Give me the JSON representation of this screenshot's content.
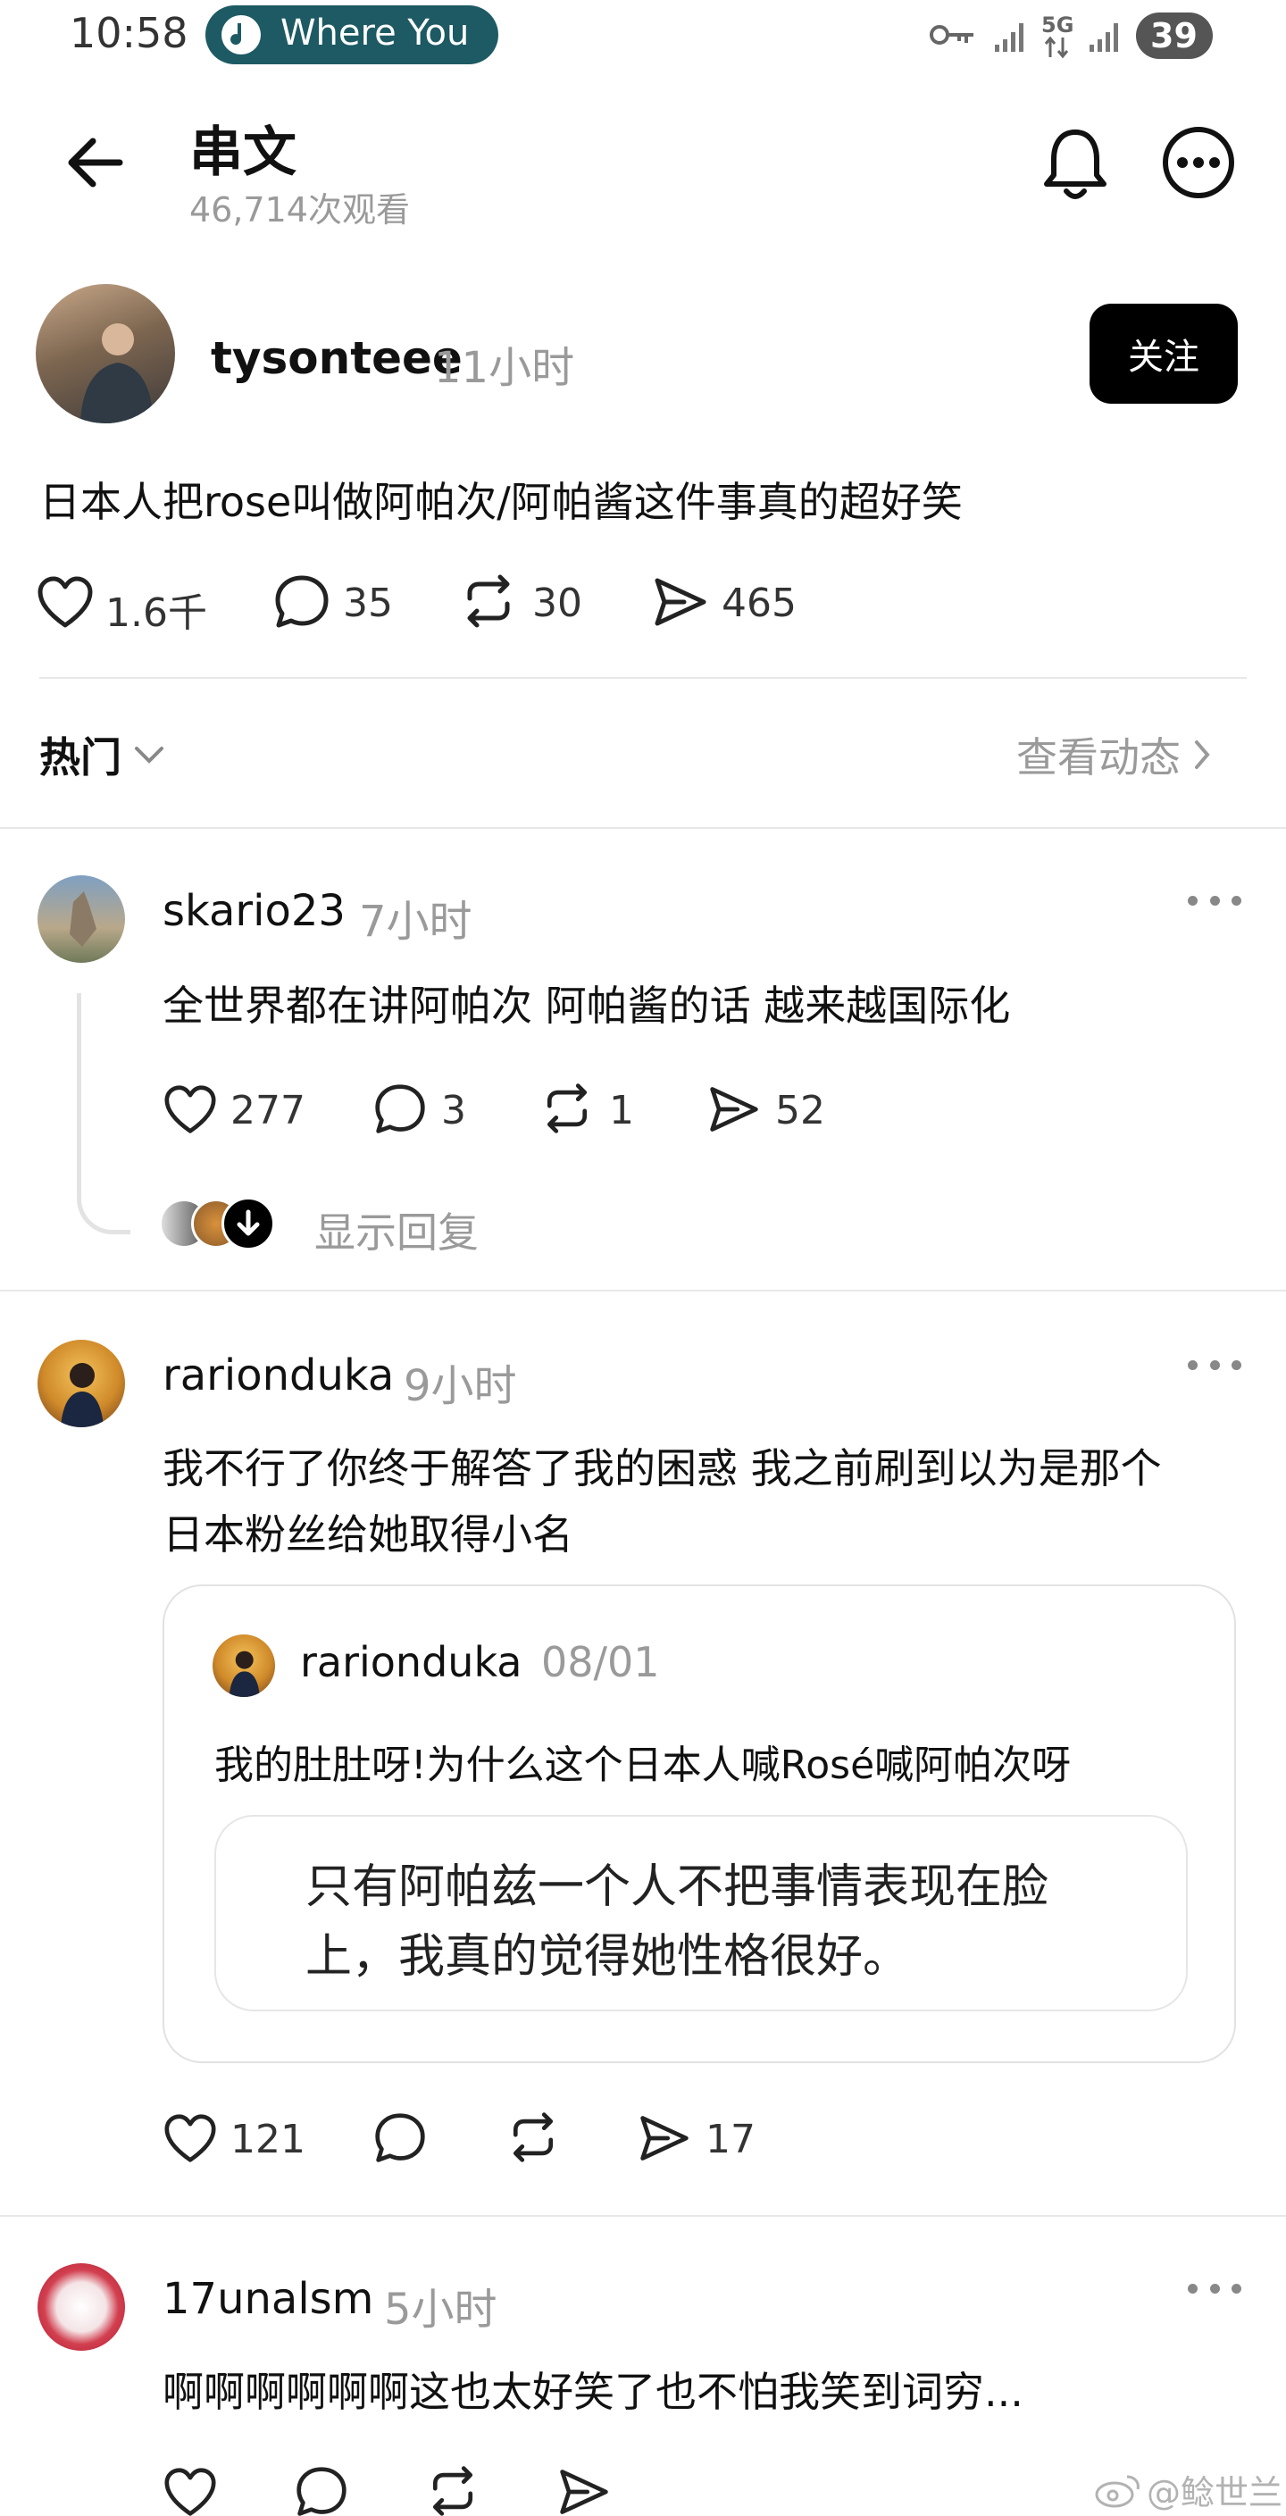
{
  "status_bar": {
    "time": "10:58",
    "music_pill": "Where You",
    "network": "5G",
    "battery": "39"
  },
  "header": {
    "title": "串文",
    "views": "46,714次观看"
  },
  "post": {
    "author": "tysonteee",
    "time": "11小时",
    "follow_label": "关注",
    "text": "日本人把rose叫做阿帕次/阿帕酱这件事真的超好笑",
    "likes": "1.6千",
    "comments": "35",
    "reposts": "30",
    "shares": "465"
  },
  "sort_bar": {
    "label": "热门",
    "activity_link": "查看动态"
  },
  "replies": [
    {
      "author": "skario23",
      "time": "7小时",
      "text": "全世界都在讲阿帕次 阿帕酱的话 越来越国际化",
      "likes": "277",
      "comments": "3",
      "reposts": "1",
      "shares": "52",
      "show_replies": "显示回复"
    },
    {
      "author": "rarionduka",
      "time": "9小时",
      "text_line1": "我不行了你终于解答了我的困惑 我之前刷到以为是那个",
      "text_line2": "日本粉丝给她取得小名",
      "quote": {
        "author": "rarionduka",
        "date": "08/01",
        "text": "我的肚肚呀!为什么这个日本人喊Rosé喊阿帕次呀",
        "inner_line1": "只有阿帕兹一个人不把事情表现在脸",
        "inner_line2": "上，我真的觉得她性格很好。"
      },
      "likes": "121",
      "shares": "17"
    },
    {
      "author": "17unalsm",
      "time": "5小时",
      "text": "啊啊啊啊啊啊这也太好笑了也不怕我笑到词穷..."
    }
  ],
  "watermark": "@鲶世兰"
}
